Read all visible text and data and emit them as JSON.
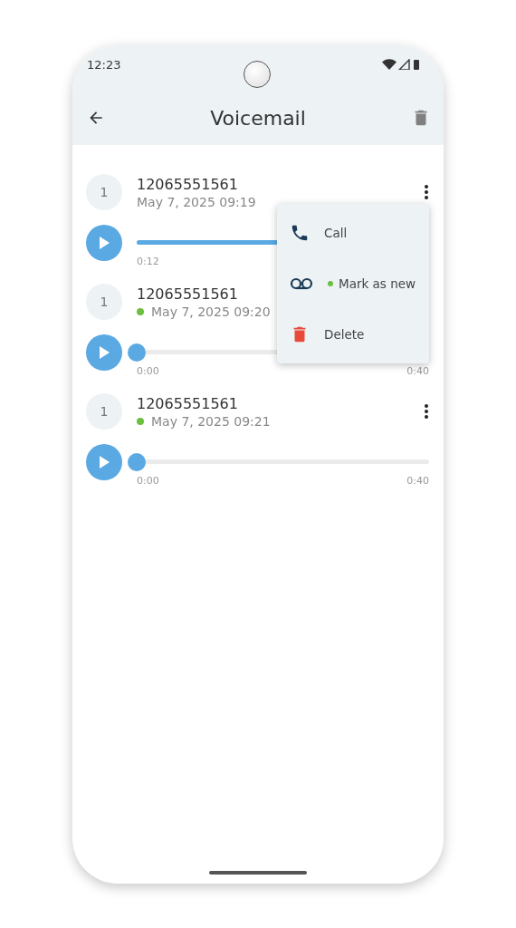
{
  "status_bar": {
    "time": "12:23"
  },
  "app_bar": {
    "title": "Voicemail"
  },
  "voicemails": [
    {
      "avatar": "1",
      "number": "12065551561",
      "date": "May 7, 2025 09:19",
      "new": false,
      "level": 0.6,
      "elapsed": "0:12",
      "thumb_shown": false,
      "more_shown": true
    },
    {
      "avatar": "1",
      "number": "12065551561",
      "date": "May 7, 2025 09:20",
      "new": true,
      "level": 0,
      "elapsed": "0:00",
      "duration": "0:40",
      "thumb_shown": true,
      "more_shown": false
    },
    {
      "avatar": "1",
      "number": "12065551561",
      "date": "May 7, 2025 09:21",
      "new": true,
      "level": 0,
      "elapsed": "0:00",
      "duration": "0:40",
      "thumb_shown": true,
      "more_shown": true
    }
  ],
  "menu": {
    "items": [
      {
        "kind": "call",
        "label": "Call",
        "dot": false
      },
      {
        "kind": "voicemail",
        "label": "Mark as new",
        "dot": true
      },
      {
        "kind": "delete",
        "label": "Delete",
        "dot": false
      }
    ]
  }
}
